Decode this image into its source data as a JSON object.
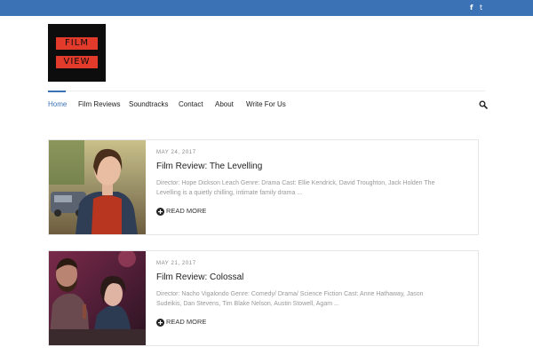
{
  "topbar": {
    "social": {
      "facebook": "f",
      "twitter": "t"
    }
  },
  "logo": {
    "line1": "FILM",
    "line2": "VIEW"
  },
  "nav": {
    "items": [
      "Home",
      "Film Reviews",
      "Soundtracks",
      "Contact",
      "About",
      "Write For Us"
    ],
    "active": "Home",
    "search_icon": "search-icon"
  },
  "posts": [
    {
      "date": "MAY 24, 2017",
      "title": "Film Review: The Levelling",
      "excerpt": "Director: Hope Dickson Leach Genre: Drama Cast: Ellie Kendrick, David Troughton, Jack Holden The Levelling is a quietly chilling, intimate family drama ...",
      "read_more": "READ MORE"
    },
    {
      "date": "MAY 21, 2017",
      "title": "Film Review: Colossal",
      "excerpt": "Director: Nacho Vigalondo Genre: Comedy/ Drama/ Science Fiction Cast: Anne Hathaway, Jason Sudeikis, Dan Stevens, Tim Blake Nelson, Austin Stowell, Agam ...",
      "read_more": "READ MORE"
    }
  ],
  "colors": {
    "accent": "#3b72b6",
    "logo_red": "#e23a2b",
    "logo_bg": "#0d0d0d"
  }
}
